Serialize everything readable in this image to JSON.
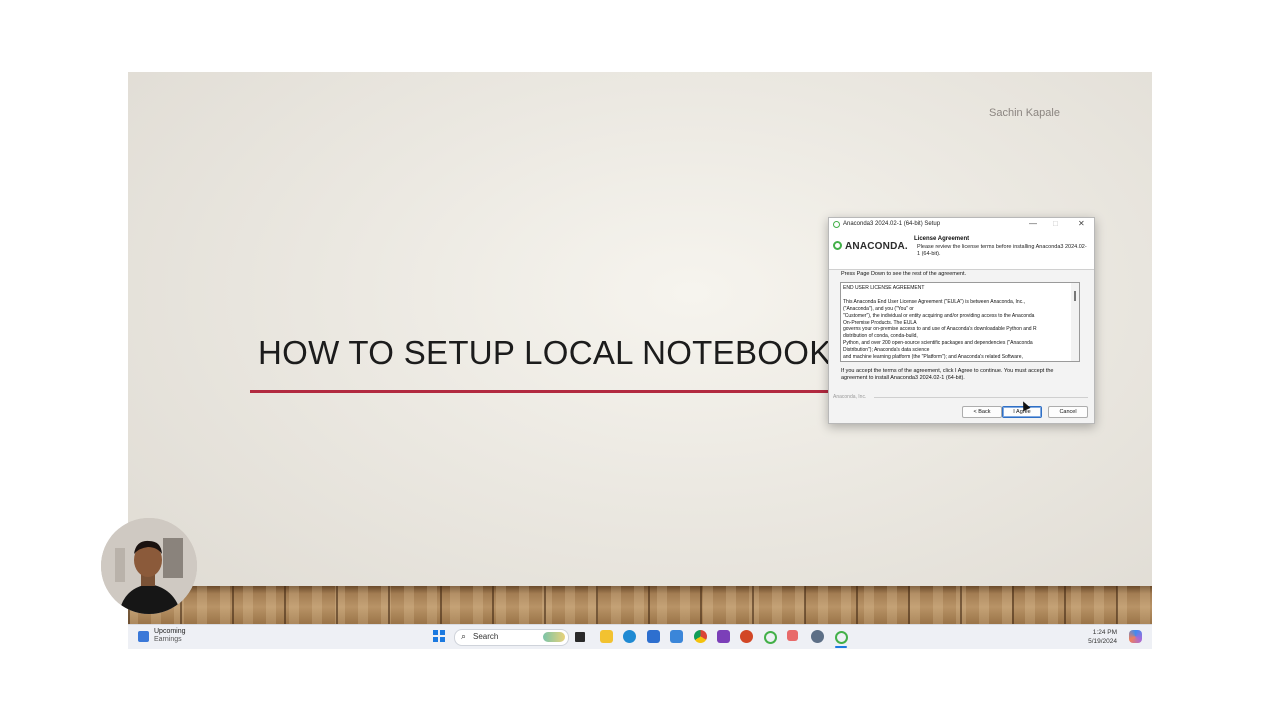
{
  "slide": {
    "author": "Sachin Kapale",
    "title": "HOW  TO SETUP LOCAL NOTEBOOK"
  },
  "dialog": {
    "window_title": "Anaconda3 2024.02-1 (64-bit) Setup",
    "logo_text": "ANACONDA.",
    "header_title": "License Agreement",
    "header_subtitle": "Please review the license terms before installing Anaconda3 2024.02-1 (64-bit).",
    "press_note": "Press Page Down to see the rest of the agreement.",
    "license_lines": [
      "END USER LICENSE AGREEMENT",
      "",
      "This Anaconda End User License Agreement (\"EULA\") is between Anaconda, Inc.,",
      "(\"Anaconda\"), and you (\"You\" or",
      "\"Customer\"), the individual or entity acquiring and/or providing access to the Anaconda",
      "On-Premise Products. The EULA",
      "governs your on-premise access to and use of Anaconda's downloadable Python and R",
      "distribution of conda, conda-build,",
      "Python, and over 200 open-source scientific packages and dependencies (\"Anaconda",
      "Distribution\"); Anaconda's data science",
      "and machine learning platform (the \"Platform\"); and Anaconda's related Software,"
    ],
    "accept_note": "If you accept the terms of the agreement, click I Agree to continue. You must accept the agreement to install Anaconda3 2024.02-1 (64-bit).",
    "brand_footer": "Anaconda, Inc.",
    "buttons": {
      "back": "< Back",
      "agree": "I Agree",
      "cancel": "Cancel"
    },
    "window_controls": {
      "minimize": "—",
      "maximize": "□",
      "close": "✕"
    }
  },
  "taskbar": {
    "widget_title": "Upcoming",
    "widget_subtitle": "Earnings",
    "search_placeholder": "Search",
    "time": "1:24 PM",
    "date": "5/19/2024",
    "pinned_icons": [
      "file-explorer-icon",
      "edge-icon",
      "mail-icon",
      "store-icon",
      "chrome-icon",
      "onenote-icon",
      "powerpoint-icon",
      "anaconda-icon",
      "snipping-icon",
      "settings-icon",
      "anaconda-setup-icon"
    ]
  },
  "colors": {
    "title_rule": "#b22a40",
    "anaconda_green": "#43b049"
  }
}
